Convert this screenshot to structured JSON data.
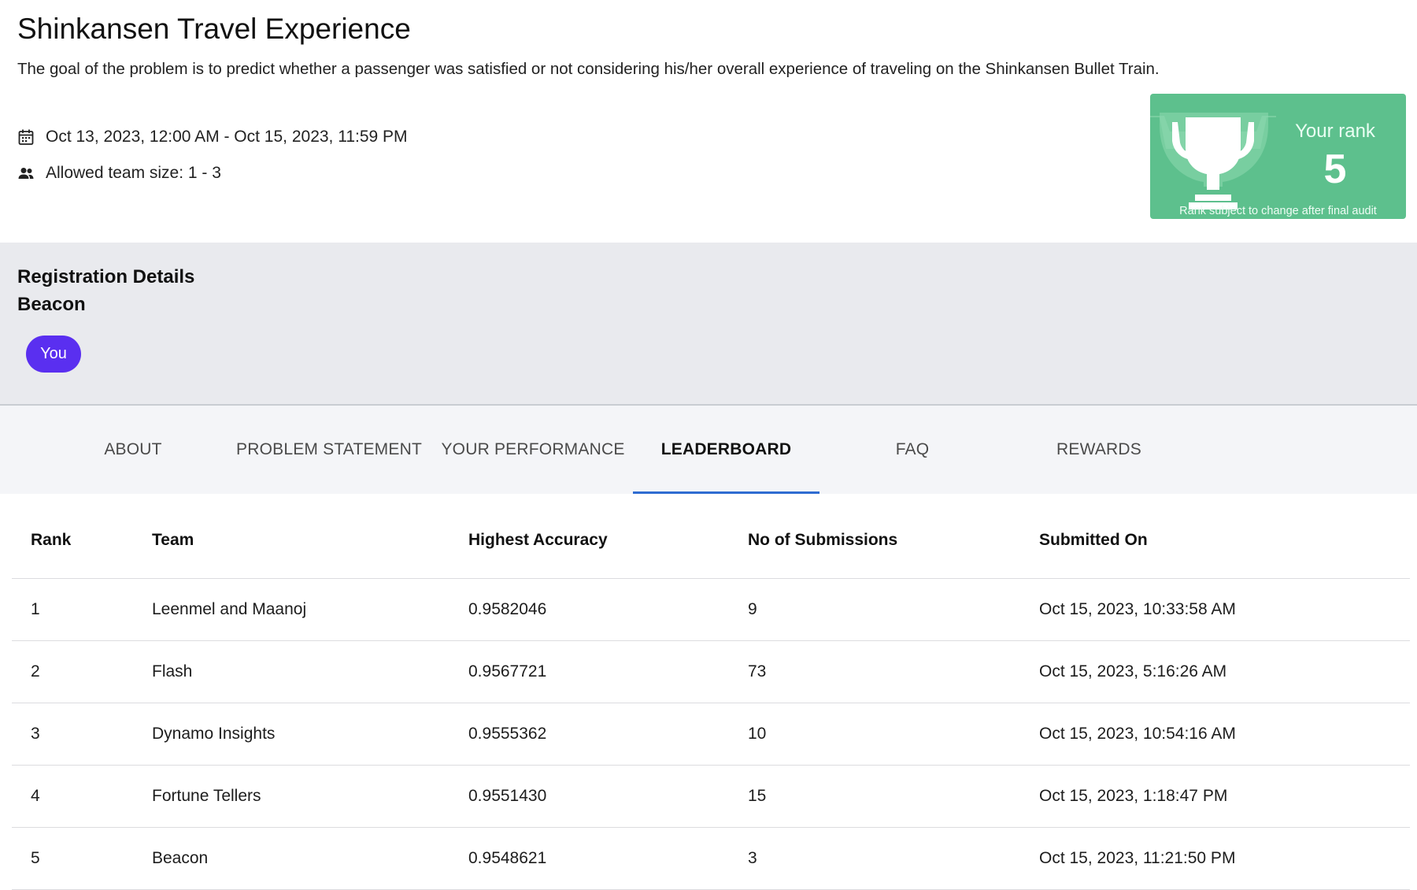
{
  "challenge": {
    "title": "Shinkansen Travel Experience",
    "description": "The goal of the problem is to predict whether a passenger was satisfied or not considering his/her overall experience of traveling on the Shinkansen Bullet Train.",
    "dates": "Oct 13, 2023, 12:00 AM - Oct 15, 2023, 11:59 PM",
    "team_size": "Allowed team size: 1 - 3"
  },
  "rank_card": {
    "label": "Your rank",
    "value": "5",
    "note": "Rank subject to change after final audit",
    "color": "#5dc08d"
  },
  "registration": {
    "title": "Registration Details",
    "team_name": "Beacon",
    "member_chip": "You",
    "chip_color": "#5a2ff0"
  },
  "tabs": [
    {
      "label": "ABOUT",
      "active": false
    },
    {
      "label": "PROBLEM STATEMENT",
      "active": false
    },
    {
      "label": "YOUR PERFORMANCE",
      "active": false
    },
    {
      "label": "LEADERBOARD",
      "active": true
    },
    {
      "label": "FAQ",
      "active": false
    },
    {
      "label": "REWARDS",
      "active": false
    }
  ],
  "leaderboard": {
    "headers": [
      "Rank",
      "Team",
      "Highest Accuracy",
      "No of Submissions",
      "Submitted On"
    ],
    "rows": [
      [
        "1",
        "Leenmel and Maanoj",
        "0.9582046",
        "9",
        "Oct 15, 2023, 10:33:58 AM"
      ],
      [
        "2",
        "Flash",
        "0.9567721",
        "73",
        "Oct 15, 2023, 5:16:26 AM"
      ],
      [
        "3",
        "Dynamo Insights",
        "0.9555362",
        "10",
        "Oct 15, 2023, 10:54:16 AM"
      ],
      [
        "4",
        "Fortune Tellers",
        "0.9551430",
        "15",
        "Oct 15, 2023, 1:18:47 PM"
      ],
      [
        "5",
        "Beacon",
        "0.9548621",
        "3",
        "Oct 15, 2023, 11:21:50 PM"
      ]
    ]
  },
  "icons": {
    "date": "calendar-icon",
    "team": "people-icon",
    "rank": "trophy-icon"
  },
  "accent_color": "#2f6cd1"
}
